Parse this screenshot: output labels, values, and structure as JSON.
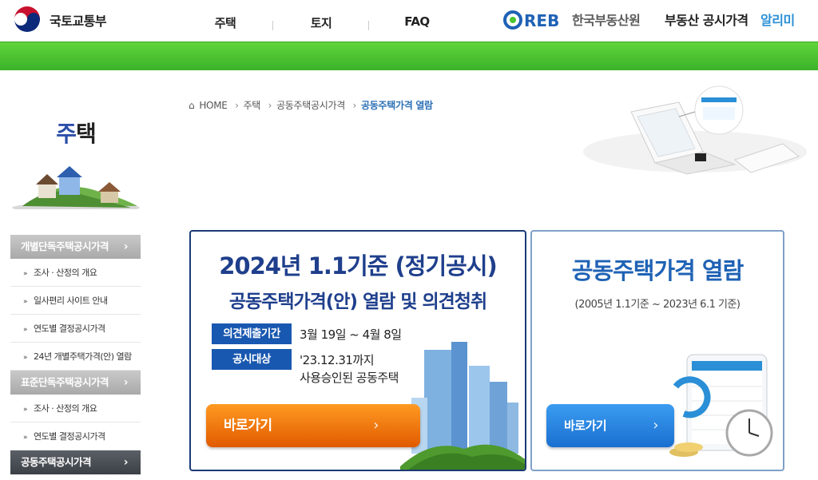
{
  "header": {
    "gov_name": "국토교통부",
    "nav": [
      "주택",
      "토지",
      "FAQ"
    ],
    "reb_logo_text": "REB",
    "reb_org": "한국부동산원",
    "reb_service": "부동산 공시가격",
    "reb_service_accent": "알리미"
  },
  "sidebar": {
    "title_first": "주",
    "title_rest": "택",
    "menu": [
      {
        "type": "category",
        "label": "개별단독주택공시가격",
        "active": false
      },
      {
        "type": "sub",
        "label": "조사 · 산정의 개요"
      },
      {
        "type": "sub",
        "label": "일사편리 사이트 안내"
      },
      {
        "type": "sub",
        "label": "연도별 결정공시가격"
      },
      {
        "type": "sub",
        "label": "24년 개별주택가격(안) 열람"
      },
      {
        "type": "category",
        "label": "표준단독주택공시가격",
        "active": false
      },
      {
        "type": "sub",
        "label": "조사 · 산정의 개요"
      },
      {
        "type": "sub",
        "label": "연도별 결정공시가격"
      },
      {
        "type": "category",
        "label": "공동주택공시가격",
        "active": true
      }
    ]
  },
  "breadcrumb": {
    "home": "HOME",
    "items": [
      "주택",
      "공동주택공시가격"
    ],
    "current": "공동주택가격 열람"
  },
  "main_card": {
    "title": "2024년 1.1기준 (정기공시)",
    "subtitle": "공동주택가격(안) 열람 및 의견청취",
    "label1": "의견제출기간",
    "value1": "3월 19일 ~ 4월 8일",
    "label2": "공시대상",
    "value2_line1": "'23.12.31까지",
    "value2_line2": "사용승인된 공동주택",
    "button": "바로가기"
  },
  "side_card": {
    "title": "공동주택가격 열람",
    "subtitle": "(2005년 1.1기준 ~ 2023년 6.1 기준)",
    "button": "바로가기"
  },
  "colors": {
    "green_bar": "#4cc530",
    "navy": "#1f3f8c",
    "blue": "#1f62b5",
    "orange": "#f07a10",
    "label_blue": "#1958b0"
  }
}
